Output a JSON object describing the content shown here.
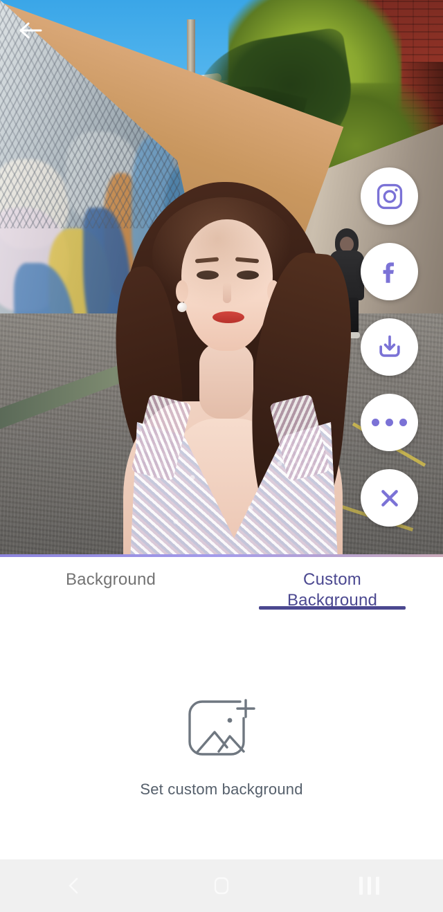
{
  "screen": {
    "title": "Background Editor Preview",
    "accent_color": "#4b4890",
    "icon_purple": "#7b72d6",
    "panel_background": "#ffffff",
    "navbar_background": "#f0f0f0"
  },
  "photo": {
    "description": "Woman in sequined dress standing in a graffiti-mural alley",
    "back_button": {
      "icon": "back-arrow-icon",
      "label": "Back"
    }
  },
  "share_actions": [
    {
      "id": "instagram",
      "icon": "instagram-icon",
      "label": "Instagram",
      "color": "#7b72d6"
    },
    {
      "id": "facebook",
      "icon": "facebook-icon",
      "label": "Facebook",
      "color": "#7b72d6"
    },
    {
      "id": "download",
      "icon": "download-icon",
      "label": "Save",
      "color": "#7b72d6"
    },
    {
      "id": "more",
      "icon": "more-horizontal-icon",
      "label": "More",
      "color": "#7b72d6"
    },
    {
      "id": "close",
      "icon": "close-icon",
      "label": "Close",
      "color": "#7b72d6"
    }
  ],
  "tabs": [
    {
      "id": "background",
      "label": "Background",
      "active": false
    },
    {
      "id": "custom-background",
      "label": "Custom\nBackground",
      "line1": "Custom",
      "line2": "Background",
      "active": true
    }
  ],
  "content": {
    "empty_state": {
      "icon": "image-add-icon",
      "label": "Set custom background"
    }
  },
  "navbar": [
    {
      "id": "back",
      "icon": "nav-back-icon",
      "label": "Back"
    },
    {
      "id": "home",
      "icon": "nav-home-icon",
      "label": "Home"
    },
    {
      "id": "recents",
      "icon": "nav-recents-icon",
      "label": "Recents"
    }
  ]
}
